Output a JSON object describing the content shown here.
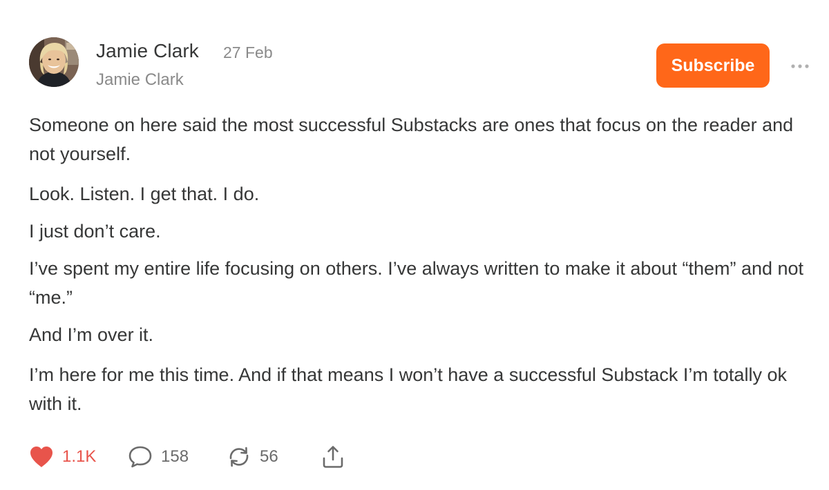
{
  "post": {
    "author_name": "Jamie Clark",
    "date": "27 Feb",
    "publication_name": "Jamie Clark",
    "avatar_icon": "avatar-photo"
  },
  "header": {
    "subscribe_label": "Subscribe",
    "more_icon": "ellipsis-icon"
  },
  "content": {
    "paragraphs": [
      "Someone on here said the most successful Substacks are ones that focus on the reader and not yourself.",
      "Look. Listen. I get that. I do.",
      "I just don’t care.",
      "I’ve spent my entire life focusing on others. I’ve always written to make it about “them” and not “me.”",
      "And I’m over it.",
      "I’m here for me this time. And if that means I won’t have a successful Substack I’m totally ok with it."
    ]
  },
  "actions": {
    "likes": "1.1K",
    "comments": "158",
    "restacks": "56",
    "like_icon": "heart-icon",
    "comment_icon": "speech-bubble-icon",
    "restack_icon": "restack-icon",
    "share_icon": "share-icon"
  },
  "colors": {
    "accent": "#ff6719",
    "like": "#e8544b",
    "text": "#363737",
    "muted": "#8a8a8a"
  }
}
